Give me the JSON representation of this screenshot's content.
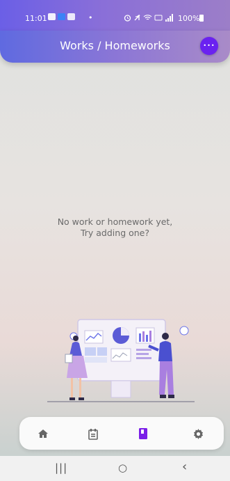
{
  "status_bar": {
    "time": "11:01",
    "bullet": "•",
    "battery": "100%"
  },
  "header": {
    "title": "Works / Homeworks",
    "more_icon": "more-horizontal-icon",
    "more_label": "•••"
  },
  "main": {
    "empty_line1": "No work or homework yet,",
    "empty_line2": "Try adding one?"
  },
  "bottom_nav": {
    "items": [
      {
        "name": "home",
        "icon": "home-icon"
      },
      {
        "name": "calendar",
        "icon": "calendar-icon"
      },
      {
        "name": "works",
        "icon": "book-icon",
        "active": true
      },
      {
        "name": "settings",
        "icon": "gear-icon"
      }
    ],
    "active_color": "#7b1fe8",
    "inactive_color": "#666666"
  },
  "system_nav": {
    "recents": "|||",
    "home": "○",
    "back": "‹"
  },
  "colors": {
    "accent": "#6a22f0",
    "header_start": "#5f6ae0",
    "header_end": "#a98bc8"
  }
}
